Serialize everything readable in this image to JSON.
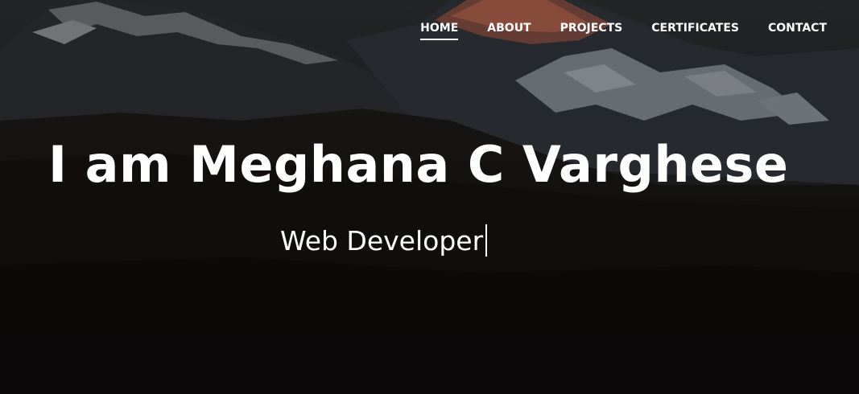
{
  "nav": {
    "items": [
      {
        "label": "HOME",
        "active": true
      },
      {
        "label": "ABOUT",
        "active": false
      },
      {
        "label": "PROJECTS",
        "active": false
      },
      {
        "label": "CERTIFICATES",
        "active": false
      },
      {
        "label": "CONTACT",
        "active": false
      }
    ]
  },
  "hero": {
    "title": "I am Meghana C Varghese",
    "subtitle": "Web Developer"
  },
  "colors": {
    "text": "#ffffff",
    "background": "#121212",
    "peak_glow": "#b35a45"
  }
}
